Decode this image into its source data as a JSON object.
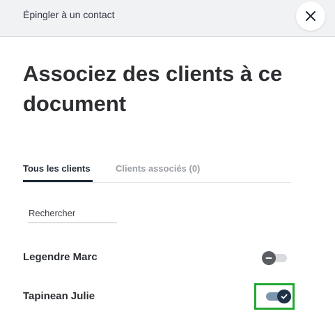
{
  "dialog": {
    "top_title": "Épingler à un contact",
    "close_icon": "close-icon",
    "headline": "Associez des clients à ce document"
  },
  "tabs": [
    {
      "label": "Tous les clients",
      "active": true
    },
    {
      "label": "Clients associés (0)",
      "active": false
    }
  ],
  "search": {
    "placeholder": "Rechercher",
    "value": ""
  },
  "clients": [
    {
      "name": "Legendre Marc",
      "associated": false
    },
    {
      "name": "Tapinean Julie",
      "associated": true
    }
  ],
  "colors": {
    "active_tab": "#1f2a36",
    "toggle_on": "#1f3145",
    "toggle_off": "#5a5d61",
    "focus_outline": "#22a832"
  }
}
